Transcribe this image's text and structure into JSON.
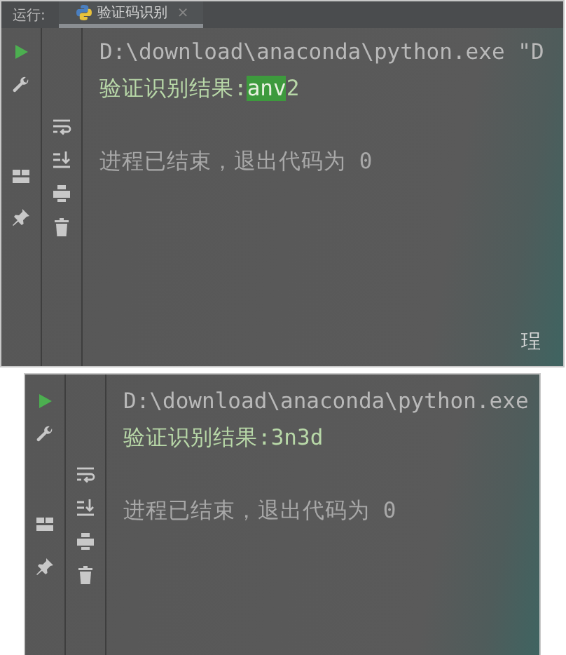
{
  "panels": [
    {
      "header": {
        "label": "运行:",
        "tab": {
          "title": "验证码识别",
          "close": "×",
          "selected": true
        }
      },
      "lines": [
        {
          "kind": "command",
          "text": "D:\\download\\anaconda\\python.exe \"D"
        },
        {
          "kind": "result",
          "label": "验证识别结果:",
          "parts": [
            {
              "text": "anv",
              "highlighted": true
            },
            {
              "text": "2",
              "highlighted": false
            }
          ]
        },
        {
          "kind": "exit",
          "text": "进程已结束，退出代码为 0"
        }
      ],
      "corner_text": "珵"
    },
    {
      "lines": [
        {
          "kind": "command",
          "text": "D:\\download\\anaconda\\python.exe"
        },
        {
          "kind": "result",
          "label": "验证识别结果:",
          "parts": [
            {
              "text": "3n3d",
              "highlighted": false
            }
          ]
        },
        {
          "kind": "exit",
          "text": "进程已结束，退出代码为 0"
        }
      ]
    }
  ]
}
